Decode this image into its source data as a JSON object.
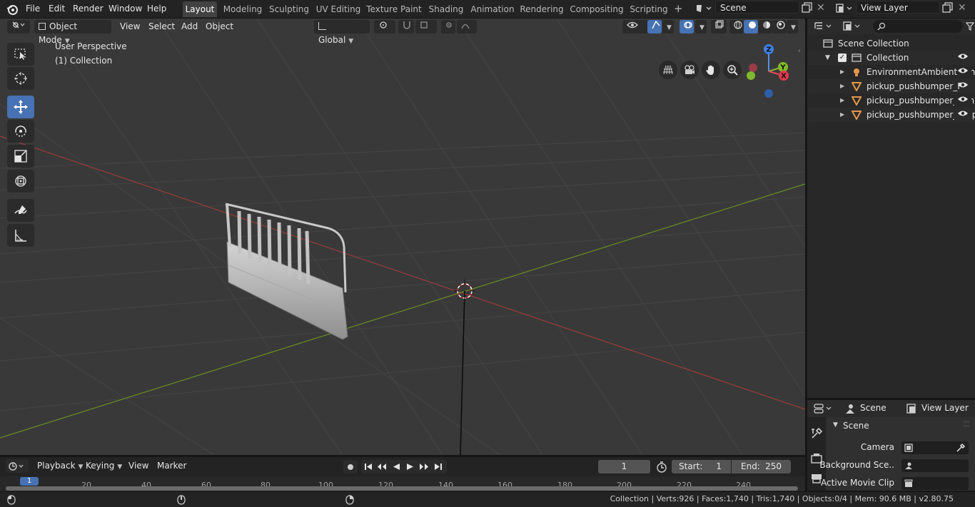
{
  "menubar": {
    "items": [
      "File",
      "Edit",
      "Render",
      "Window",
      "Help"
    ],
    "workspaces": [
      "Layout",
      "Modeling",
      "Sculpting",
      "UV Editing",
      "Texture Paint",
      "Shading",
      "Animation",
      "Rendering",
      "Compositing",
      "Scripting"
    ],
    "active_workspace": "Layout",
    "scene_name": "Scene",
    "view_layer": "View Layer"
  },
  "viewport_header": {
    "mode": "Object Mode",
    "menus": [
      "View",
      "Select",
      "Add",
      "Object"
    ],
    "transform_orientation": "Global"
  },
  "viewport": {
    "perspective": "User Perspective",
    "collection": "(1) Collection",
    "gizmo": {
      "x": "X",
      "y": "Y",
      "z": "Z"
    }
  },
  "outliner": {
    "root": "Scene Collection",
    "collection": "Collection",
    "objects": [
      "EnvironmentAmbientLight",
      "pickup_pushbumper_F",
      "pickup_pushbumper_F_in",
      "pickup_pushbumper_F_up"
    ]
  },
  "properties": {
    "tabs": [
      "Scene",
      "View Layer"
    ],
    "section": "Scene",
    "rows": [
      {
        "label": "Camera"
      },
      {
        "label": "Background Sce.."
      },
      {
        "label": "Active Movie Clip"
      }
    ]
  },
  "timeline": {
    "menus": [
      "Playback",
      "Keying",
      "View",
      "Marker"
    ],
    "current_frame": "1",
    "start_label": "Start:",
    "start": "1",
    "end_label": "End:",
    "end": "250",
    "ticks": [
      "1",
      "20",
      "40",
      "60",
      "80",
      "100",
      "120",
      "140",
      "160",
      "180",
      "200",
      "220",
      "240"
    ]
  },
  "status": "Collection | Verts:926 | Faces:1,740 | Tris:1,740 | Objects:0/4 | Mem: 90.6 MB | v2.80.75",
  "colors": {
    "accent": "#4772b3",
    "x_axis": "#9b3b3b",
    "y_axis": "#6b8e23",
    "object_icon": "#e3964a"
  }
}
